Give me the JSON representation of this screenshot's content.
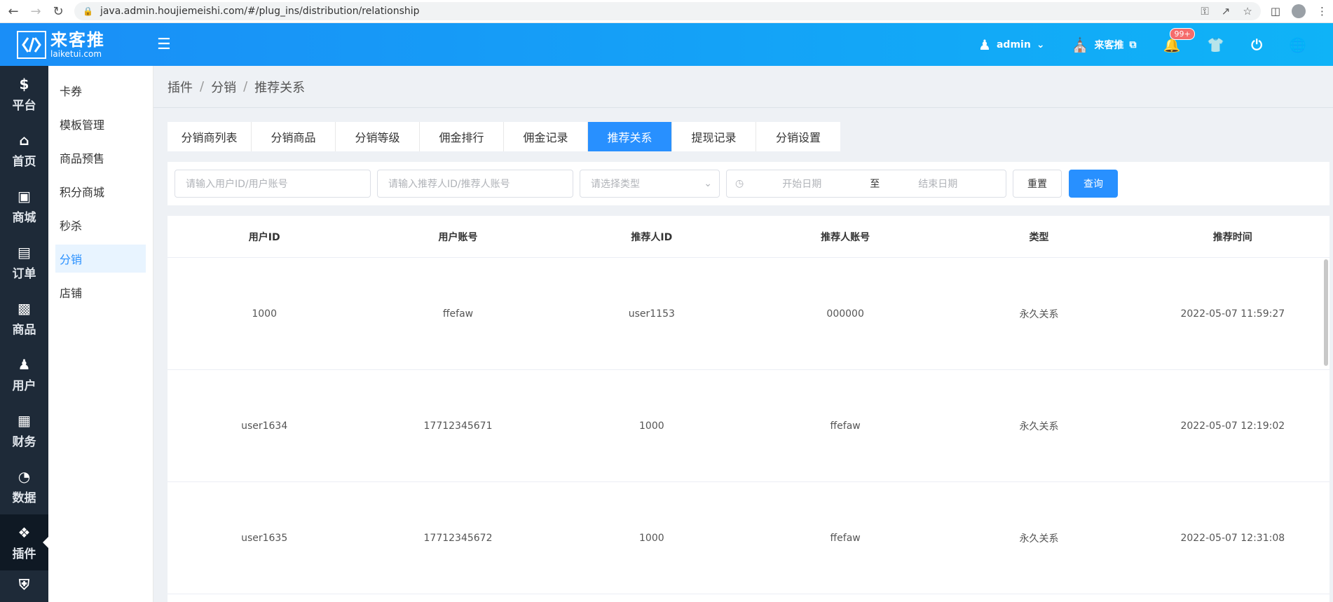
{
  "browser": {
    "url": "java.admin.houjiemeishi.com/#/plug_ins/distribution/relationship"
  },
  "header": {
    "logo_cn": "来客推",
    "logo_en": "laiketui.com",
    "user": "admin",
    "store": "来客推",
    "notify_badge": "99+"
  },
  "sidebar": {
    "items": [
      {
        "label": "平台",
        "icon": "dollar-icon"
      },
      {
        "label": "首页",
        "icon": "home-icon"
      },
      {
        "label": "商城",
        "icon": "shop-icon"
      },
      {
        "label": "订单",
        "icon": "clipboard-icon"
      },
      {
        "label": "商品",
        "icon": "bag-icon"
      },
      {
        "label": "用户",
        "icon": "user-icon"
      },
      {
        "label": "财务",
        "icon": "wallet-icon"
      },
      {
        "label": "数据",
        "icon": "pie-icon"
      },
      {
        "label": "插件",
        "icon": "puzzle-icon"
      }
    ]
  },
  "submenu": {
    "items": [
      "卡券",
      "模板管理",
      "商品预售",
      "积分商城",
      "秒杀",
      "分销",
      "店铺"
    ]
  },
  "breadcrumb": [
    "插件",
    "分销",
    "推荐关系"
  ],
  "tabs": [
    "分销商列表",
    "分销商品",
    "分销等级",
    "佣金排行",
    "佣金记录",
    "推荐关系",
    "提现记录",
    "分销设置"
  ],
  "filters": {
    "user_placeholder": "请输入用户ID/用户账号",
    "ref_placeholder": "请输入推荐人ID/推荐人账号",
    "type_placeholder": "请选择类型",
    "date_start": "开始日期",
    "date_sep": "至",
    "date_end": "结束日期",
    "reset_label": "重置",
    "query_label": "查询"
  },
  "table": {
    "columns": [
      "用户ID",
      "用户账号",
      "推荐人ID",
      "推荐人账号",
      "类型",
      "推荐时间"
    ],
    "rows": [
      [
        "1000",
        "ffefaw",
        "user1153",
        "000000",
        "永久关系",
        "2022-05-07 11:59:27"
      ],
      [
        "user1634",
        "17712345671",
        "1000",
        "ffefaw",
        "永久关系",
        "2022-05-07 12:19:02"
      ],
      [
        "user1635",
        "17712345672",
        "1000",
        "ffefaw",
        "永久关系",
        "2022-05-07 12:31:08"
      ]
    ]
  },
  "colors": {
    "primary": "#2890ff",
    "sidebar_bg": "#1e2a38",
    "header_start": "#1a8ef7",
    "header_end": "#0fb3f7"
  }
}
